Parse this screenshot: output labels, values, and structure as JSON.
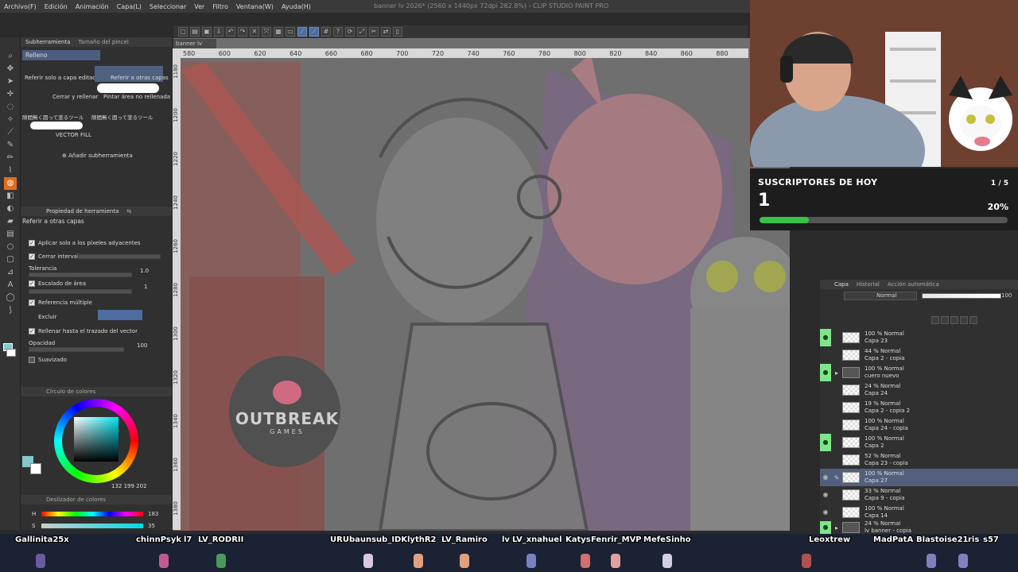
{
  "window": {
    "title": "banner lv 2026* (2560 x 1440px 72dpi 282.8%) - CLIP STUDIO PAINT PRO"
  },
  "menu": [
    "Archivo(F)",
    "Edición",
    "Animación",
    "Capa(L)",
    "Seleccionar",
    "Ver",
    "Filtro",
    "Ventana(W)",
    "Ayuda(H)"
  ],
  "subtool_panel": {
    "tabs": [
      "Subherramienta",
      "Tamaño del pincel"
    ],
    "selected_group": "Relleno",
    "options": [
      "Referir solo a capa editada",
      "Referir a otras capas",
      "Cerrar y rellenar",
      "Pintar área no rellenada",
      "隙間無く囲って塗るツール",
      "隙間無く囲って塗るツール",
      "VECTOR FILL"
    ],
    "add_label": "Añadir subherramienta"
  },
  "tool_property": {
    "tabs": [
      "Propiedad de herramienta",
      "⇆"
    ],
    "tool_name": "Referir a otras capas",
    "rows": {
      "apply_adjacent": "Aplicar solo a los píxeles adyacentes",
      "close_gap": "Cerrar intervalo",
      "tolerance": "Tolerancia",
      "tolerance_value": "1.0",
      "area_scaling": "Escalado de área",
      "area_scaling_value": "1",
      "multi_ref": "Referencia múltiple",
      "exclude": "Excluir",
      "fill_vector": "Rellenar hasta el trazado del vector",
      "opacity": "Opacidad",
      "opacity_value": "100",
      "smoothing": "Suavizado"
    }
  },
  "color_wheel": {
    "title": "Círculo de colores",
    "rgb": "132 199 202",
    "color": "#84c7ca"
  },
  "color_slider": {
    "title": "Deslizador de colores",
    "h": "183",
    "s": "35"
  },
  "canvas": {
    "tab": "banner lv 2026*",
    "ruler_top": [
      "580",
      "600",
      "620",
      "640",
      "660",
      "680",
      "700",
      "720",
      "740",
      "760",
      "780",
      "800",
      "820",
      "840",
      "860",
      "880"
    ],
    "ruler_left": [
      "1180",
      "1200",
      "1220",
      "1240",
      "1260",
      "1280",
      "1300",
      "1320",
      "1340",
      "1360",
      "1380"
    ],
    "logo_line1": "OUTBREAK",
    "logo_line2": "GAMES"
  },
  "subs_widget": {
    "title": "SUSCRIPTORES DE HOY",
    "count": "1",
    "goal": "1 / 5",
    "percent": "20%",
    "progress": 0.2
  },
  "layer_panel": {
    "tabs": [
      "Capa",
      "Historial",
      "Acción automática"
    ],
    "blend_mode": "Normal",
    "opacity": "100",
    "layers": [
      {
        "pct": "100 % Normal",
        "name": "Capa 23",
        "eye": true,
        "selected": false
      },
      {
        "pct": "44 % Normal",
        "name": "Capa 2 - copia",
        "eye": false,
        "selected": false
      },
      {
        "pct": "100 % Normal",
        "name": "cuero nuevo",
        "eye": true,
        "selected": false
      },
      {
        "pct": "24 % Normal",
        "name": "Capa 24",
        "eye": false,
        "selected": false
      },
      {
        "pct": "19 % Normal",
        "name": "Capa 2 - copia 2",
        "eye": false,
        "selected": false
      },
      {
        "pct": "100 % Normal",
        "name": "Capa 24 - copia",
        "eye": false,
        "selected": false
      },
      {
        "pct": "100 % Normal",
        "name": "Capa 2",
        "eye": true,
        "selected": false
      },
      {
        "pct": "52 % Normal",
        "name": "Capa 23 - copia",
        "eye": false,
        "selected": false
      },
      {
        "pct": "100 % Normal",
        "name": "Capa 27",
        "eye": false,
        "selected": true
      },
      {
        "pct": "33 % Normal",
        "name": "Capa 9 - copia",
        "eye": false,
        "selected": false
      },
      {
        "pct": "100 % Normal",
        "name": "Capa 14",
        "eye": false,
        "selected": false
      },
      {
        "pct": "24 % Normal",
        "name": "lv banner - copia",
        "eye": true,
        "selected": false
      }
    ]
  },
  "chat_names": [
    "Gallinita25x",
    "chinnPsyk",
    "l7",
    "LV_RODRII",
    "URUbaunsub_IDK",
    "lythR2",
    "LV_Ramiro",
    "lv",
    "LV_xnahuel",
    "Katys",
    "Fenrir_MVP",
    "MefeSinho",
    "Leoxtrew",
    "MadPatA",
    "Blastoise21",
    "ris",
    "s57"
  ]
}
